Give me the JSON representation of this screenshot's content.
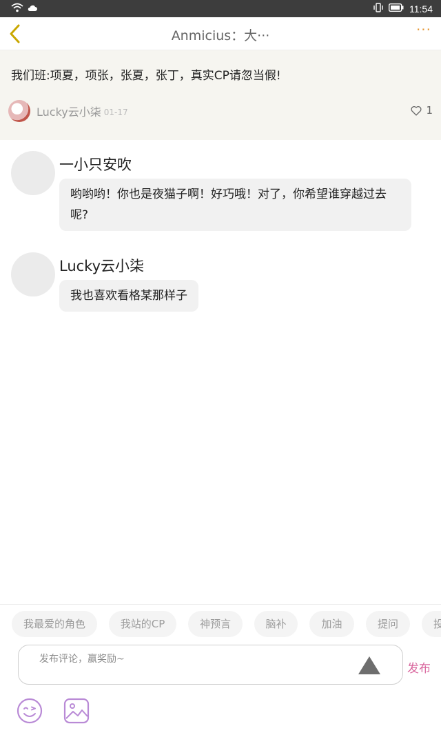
{
  "statusbar": {
    "time": "11:54"
  },
  "nav": {
    "title": "Anmicius：大···",
    "more": "···"
  },
  "post": {
    "text": "我们班:项夏，项张，张夏，张丁，真实CP请忽当假!",
    "author": "Lucky云小柒",
    "date": "01-17",
    "likes": "1"
  },
  "comments": [
    {
      "name": "一小只安吹",
      "text": "哟哟哟！你也是夜猫子啊！好巧哦！对了，你希望谁穿越过去呢?"
    },
    {
      "name": "Lucky云小柒",
      "text": "我也喜欢看格某那样子"
    }
  ],
  "tags": [
    "我最爱的角色",
    "我站的CP",
    "神预言",
    "脑补",
    "加油",
    "提问",
    "投"
  ],
  "input": {
    "placeholder": "发布评论，赢奖励~",
    "send_label": "发布"
  },
  "colors": {
    "accent": "#d9679e",
    "nav_more": "#e79a3b",
    "icon_purple": "#b98ad6"
  }
}
